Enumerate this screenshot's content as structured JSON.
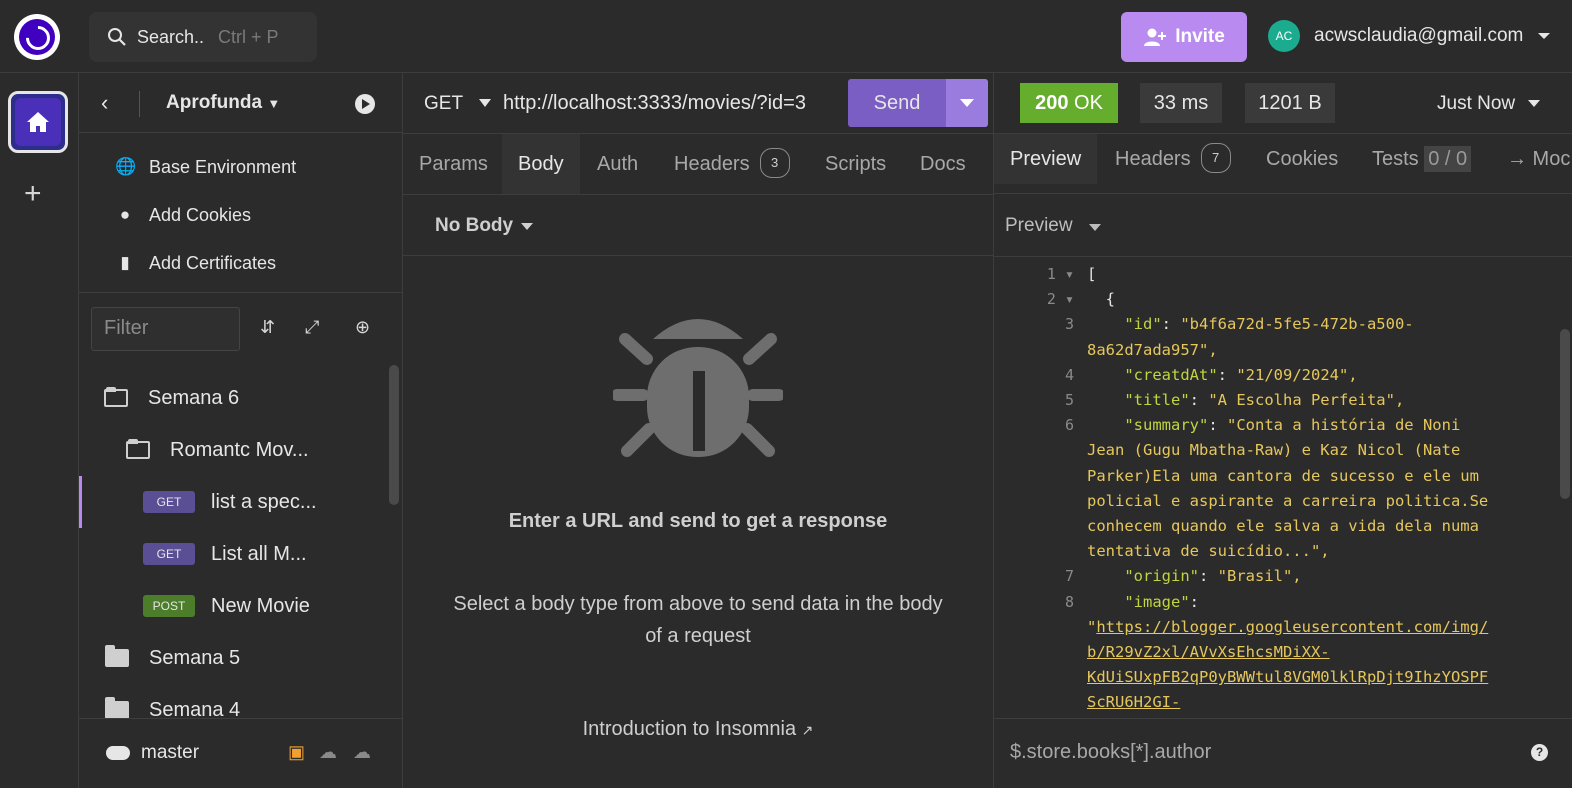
{
  "topbar": {
    "search_label": "Search..",
    "search_shortcut": "Ctrl + P",
    "invite_label": "Invite",
    "user_initials": "AC",
    "user_email": "acwsclaudia@gmail.com"
  },
  "sidebar": {
    "project_name": "Aprofunda",
    "env_items": [
      {
        "label": "Base Environment",
        "icon": "globe-icon"
      },
      {
        "label": "Add Cookies",
        "icon": "cookie-icon"
      },
      {
        "label": "Add Certificates",
        "icon": "certificate-icon"
      }
    ],
    "filter_placeholder": "Filter",
    "tree": [
      {
        "type": "folder-open",
        "label": "Semana 6"
      },
      {
        "type": "folder-open",
        "label": "Romantc Mov..."
      },
      {
        "type": "request",
        "method": "GET",
        "label": "list a spec...",
        "active": true
      },
      {
        "type": "request",
        "method": "GET",
        "label": "List all M..."
      },
      {
        "type": "request",
        "method": "POST",
        "label": "New Movie"
      },
      {
        "type": "folder",
        "label": "Semana 5"
      },
      {
        "type": "folder",
        "label": "Semana 4"
      }
    ],
    "branch": "master"
  },
  "request": {
    "method": "GET",
    "url": "http://localhost:3333/movies/?id=3",
    "send_label": "Send",
    "tabs": [
      {
        "label": "Params"
      },
      {
        "label": "Body",
        "active": true
      },
      {
        "label": "Auth"
      },
      {
        "label": "Headers",
        "badge": "3"
      },
      {
        "label": "Scripts"
      },
      {
        "label": "Docs"
      }
    ],
    "body_type": "No Body",
    "empty_title": "Enter a URL and send to get a response",
    "empty_sub": "Select a body type from above to send data in the body of a request",
    "intro_link": "Introduction to Insomnia"
  },
  "response": {
    "status_code": "200",
    "status_text": "OK",
    "time": "33 ms",
    "size": "1201 B",
    "timestamp": "Just Now",
    "tabs": [
      {
        "label": "Preview",
        "active": true
      },
      {
        "label": "Headers",
        "badge": "7"
      },
      {
        "label": "Cookies"
      },
      {
        "label": "Tests",
        "badge": "0 / 0"
      },
      {
        "label": "→ Moc"
      }
    ],
    "preview_mode": "Preview",
    "filter_query": "$.store.books[*].author",
    "colors": {
      "status_ok": "#65ad2c",
      "accent": "#b98bf0",
      "json_key": "#c0d53f",
      "json_string": "#e6c75c"
    }
  },
  "code_lines": [
    {
      "n": "1",
      "fold": true,
      "text": "["
    },
    {
      "n": "2",
      "fold": true,
      "text": "  {"
    },
    {
      "n": "3",
      "key": "\"id\"",
      "value": "\"b4f6a72d-5fe5-472b-a500-"
    },
    {
      "n": "",
      "cont": "8a62d7ada957\","
    },
    {
      "n": "4",
      "key": "\"creatdAt\"",
      "value": "\"21/09/2024\","
    },
    {
      "n": "5",
      "key": "\"title\"",
      "value": "\"A Escolha Perfeita\","
    },
    {
      "n": "6",
      "key": "\"summary\"",
      "value": "\"Conta a história de Noni"
    },
    {
      "n": "",
      "cont": "Jean (Gugu Mbatha-Raw) e Kaz Nicol (Nate"
    },
    {
      "n": "",
      "cont": "Parker)Ela uma cantora de sucesso e ele um"
    },
    {
      "n": "",
      "cont": "policial e aspirante a carreira politica.Se"
    },
    {
      "n": "",
      "cont": "conhecem quando ele salva a vida dela numa"
    },
    {
      "n": "",
      "cont": "tentativa de suicídio...\","
    },
    {
      "n": "7",
      "key": "\"origin\"",
      "value": "\"Brasil\","
    },
    {
      "n": "8",
      "key": "\"image\"",
      "value": ""
    },
    {
      "n": "",
      "urlpre": "\"",
      "url": "https://blogger.googleusercontent.com/img/"
    },
    {
      "n": "",
      "url": "b/R29vZ2xl/AVvXsEhcsMDiXX-"
    },
    {
      "n": "",
      "url": "KdUiSUxpFB2qP0yBWWtul8VGM0lklRpDjt9IhzYOSPF"
    },
    {
      "n": "",
      "url": "ScRU6H2GI-"
    }
  ]
}
